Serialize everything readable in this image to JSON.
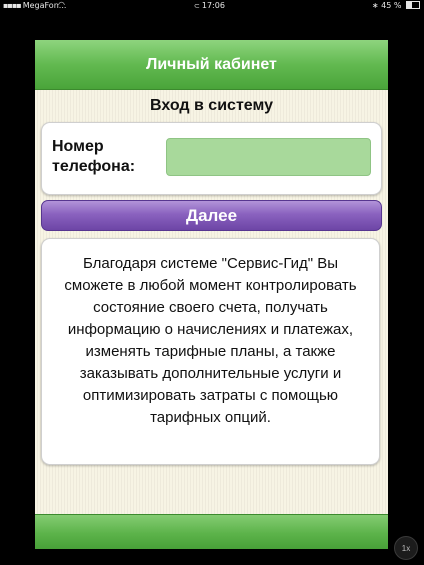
{
  "status_bar": {
    "carrier": "MegaFon...",
    "time": "17:06",
    "battery": "45 %"
  },
  "nav": {
    "title": "Личный кабинет"
  },
  "login": {
    "section_title": "Вход в систему",
    "phone_label": "Номер телефона:",
    "phone_value": "",
    "next_label": "Далее"
  },
  "info": {
    "text": "Благодаря системе \"Сервис-Гид\" Вы сможете в любой момент контролировать состояние своего счета, получать информацию о начислениях и платежах, изменять тарифные планы, а также заказывать дополнительные услуги и оптимизировать затраты с помощью тарифных опций."
  },
  "zoom": {
    "label": "1x"
  },
  "colors": {
    "nav_green": "#62b950",
    "input_green": "#a8d99b",
    "button_purple": "#8a62bf",
    "background_cream": "#f7f4e4"
  },
  "icons": [
    "signal-icon",
    "wifi-icon",
    "lock-icon",
    "bluetooth-icon",
    "battery-icon"
  ]
}
